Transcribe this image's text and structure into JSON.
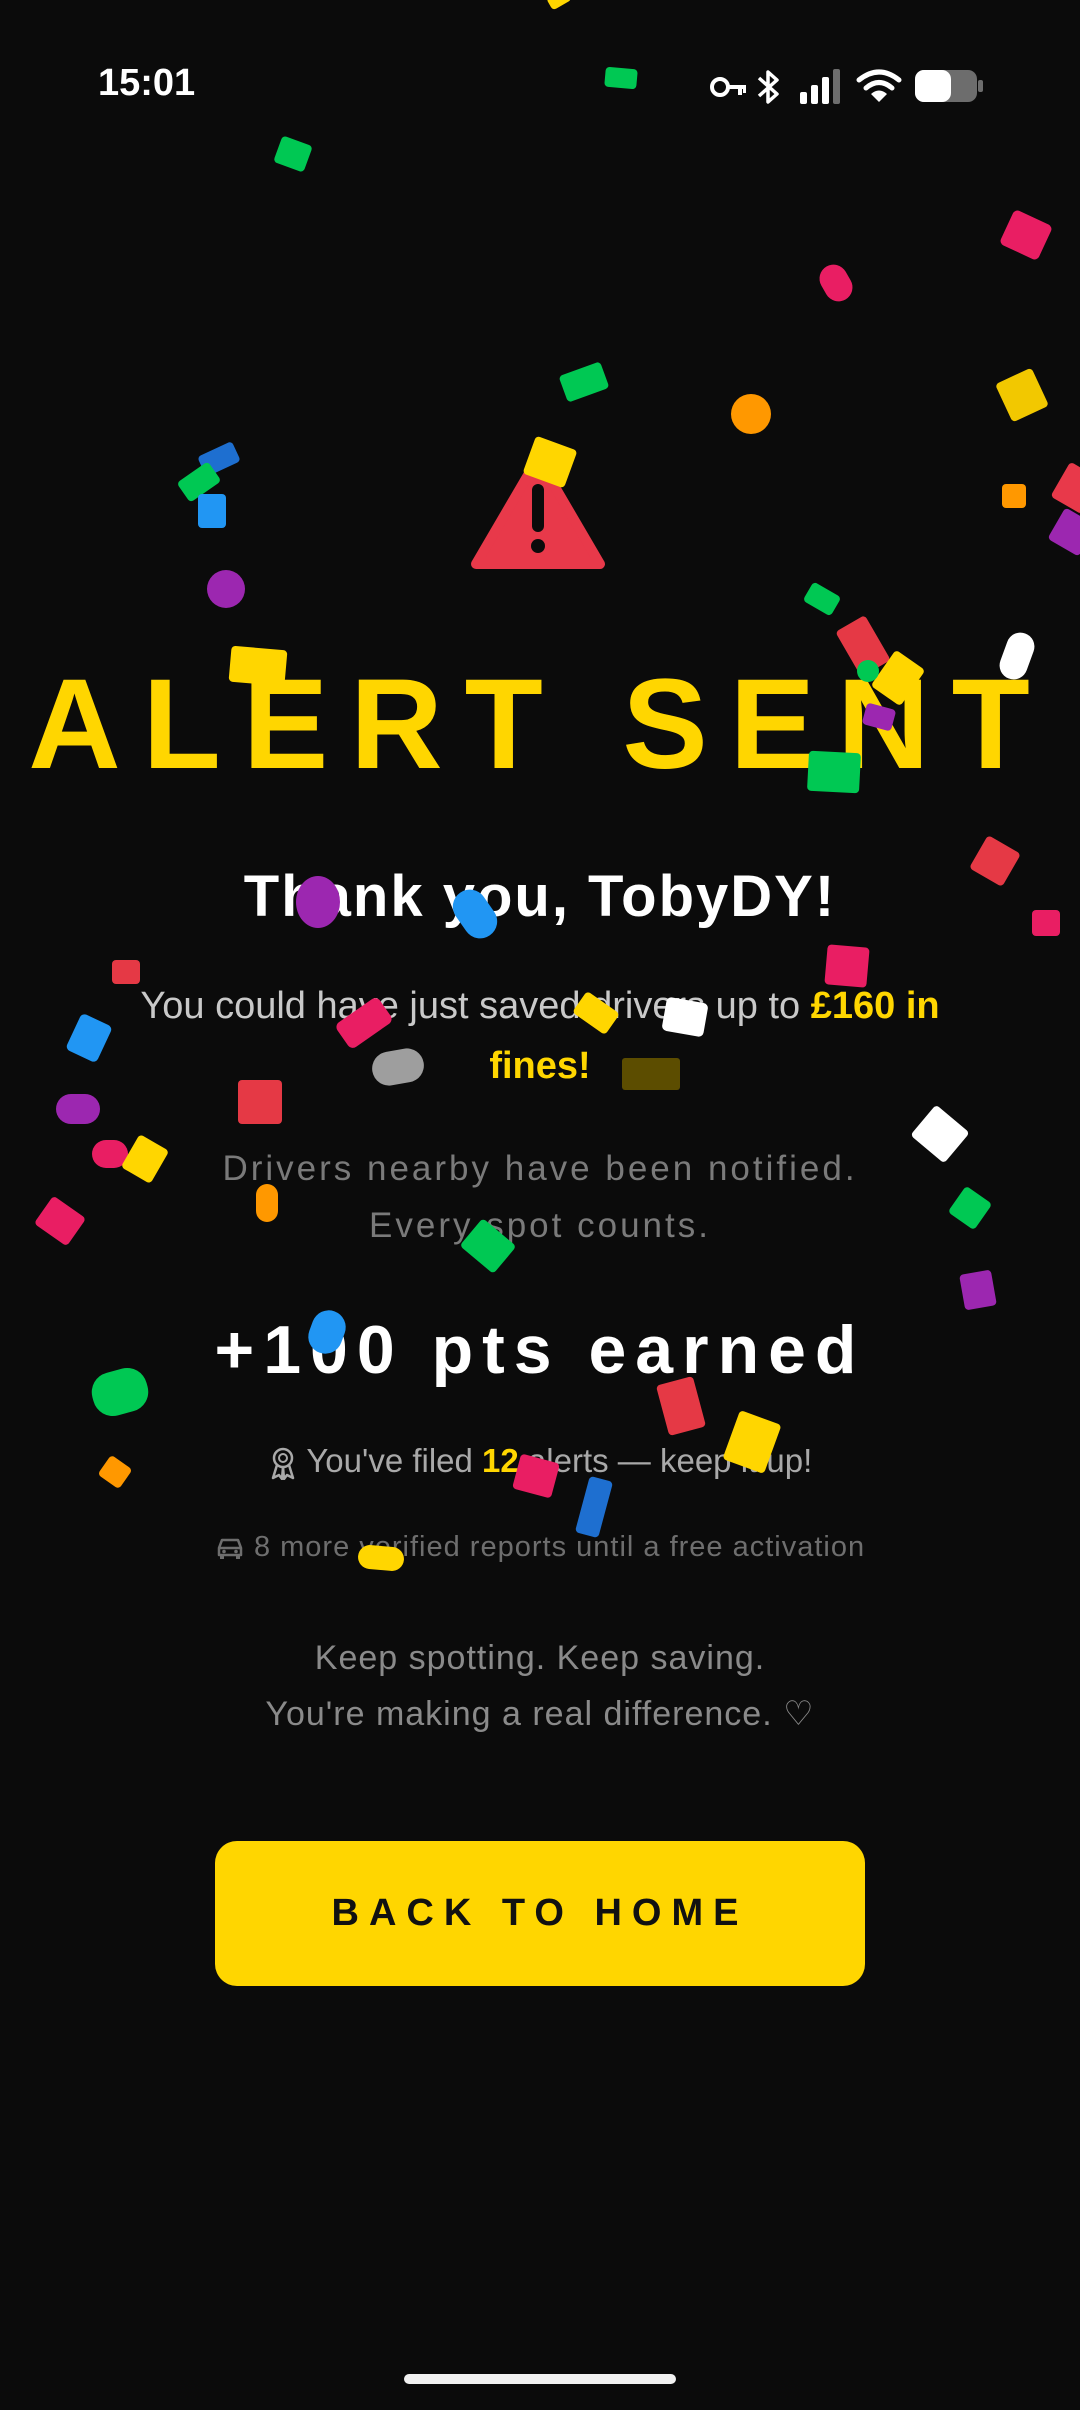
{
  "status_bar": {
    "time": "15:01",
    "icons": [
      "key-icon",
      "bluetooth-icon",
      "cellular-signal-icon",
      "wifi-icon",
      "battery-icon"
    ]
  },
  "hero": {
    "icon": "warning-triangle-icon",
    "title": "ALERT SENT"
  },
  "thanks": {
    "text": "Thank you, TobyDY!"
  },
  "savings": {
    "prefix": "You could have just saved drivers up to ",
    "amount": "£160 in fines!"
  },
  "notified": {
    "line1": "Drivers nearby have been notified.",
    "line2": "Every spot counts."
  },
  "points": {
    "text": "+100 pts earned"
  },
  "filed": {
    "icon": "award-ribbon-icon",
    "prefix": "You've filed ",
    "count": "12",
    "suffix": " alerts — keep it up!"
  },
  "verified": {
    "icon": "car-icon",
    "text": "8 more verified reports until a free activation"
  },
  "keep": {
    "line1": "Keep spotting. Keep saving.",
    "line2": "You're making a real difference. ♡"
  },
  "actions": {
    "back_home": "BACK TO HOME"
  },
  "colors": {
    "background": "#0b0b0b",
    "accent": "#ffd600",
    "warning": "#e8394a",
    "confetti": [
      "#ffd600",
      "#00c853",
      "#e91e63",
      "#2196f3",
      "#9c27b0",
      "#ff9800",
      "#ffffff",
      "#e53945"
    ]
  }
}
